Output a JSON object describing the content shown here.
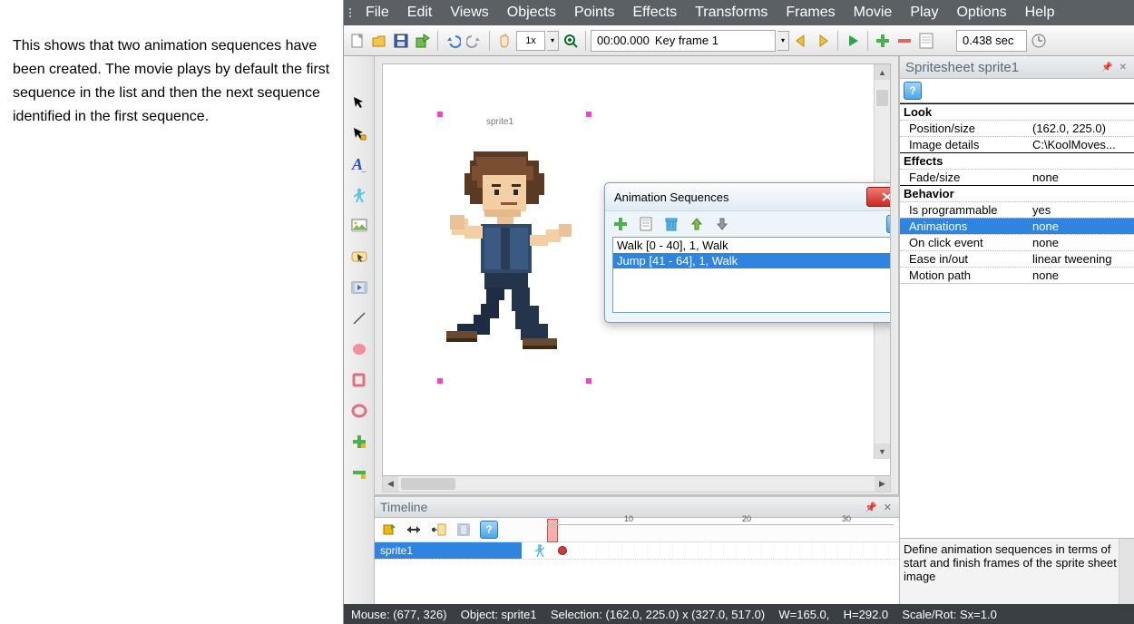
{
  "doc_text": "This shows that two animation sequences have been created. The movie plays by default the first sequence in the list and then the next sequence identified in the first sequence.",
  "menu": [
    "File",
    "Edit",
    "Views",
    "Objects",
    "Points",
    "Effects",
    "Transforms",
    "Frames",
    "Movie",
    "Play",
    "Options",
    "Help"
  ],
  "toolbar": {
    "speed": "1x",
    "frame_time": "00:00.000",
    "frame_label": "Key frame 1",
    "duration": "0.438 sec"
  },
  "canvas": {
    "sprite_name": "sprite1"
  },
  "dialog": {
    "title": "Animation Sequences",
    "rows": [
      {
        "text": "Walk [0 - 40], 1, Walk",
        "selected": false
      },
      {
        "text": "Jump [41 - 64], 1, Walk",
        "selected": true
      }
    ]
  },
  "timeline": {
    "title": "Timeline",
    "ticks": [
      "10",
      "20",
      "30"
    ],
    "track_name": "sprite1"
  },
  "props": {
    "title": "Spritesheet sprite1",
    "sections": [
      {
        "name": "Look",
        "rows": [
          {
            "k": "Position/size",
            "v": "(162.0, 225.0)"
          },
          {
            "k": "Image details",
            "v": "C:\\KoolMoves..."
          }
        ]
      },
      {
        "name": "Effects",
        "rows": [
          {
            "k": "Fade/size",
            "v": "none"
          }
        ]
      },
      {
        "name": "Behavior",
        "rows": [
          {
            "k": "Is programmable",
            "v": "yes"
          },
          {
            "k": "Animations",
            "v": "none",
            "selected": true
          },
          {
            "k": "On click event",
            "v": "none"
          },
          {
            "k": "Ease in/out",
            "v": "linear tweening"
          },
          {
            "k": "Motion path",
            "v": "none"
          }
        ]
      }
    ],
    "desc": "Define animation sequences in terms of start and finish frames of the sprite sheet image"
  },
  "status": {
    "mouse": "Mouse: (677, 326)",
    "object": "Object: sprite1",
    "selection": "Selection: (162.0, 225.0) x (327.0, 517.0)",
    "w": "W=165.0,",
    "h": "H=292.0",
    "scale": "Scale/Rot: Sx=1.0"
  }
}
